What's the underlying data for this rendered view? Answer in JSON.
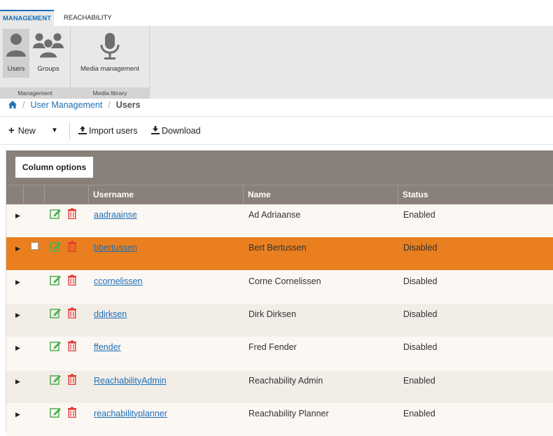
{
  "tabs": {
    "management": "MANAGEMENT",
    "reachability": "REACHABILITY"
  },
  "ribbon": {
    "users_label": "Users",
    "groups_label": "Groups",
    "media_label": "Media management",
    "group1_label": "Management",
    "group2_label": "Media library"
  },
  "breadcrumb": {
    "home_icon": "home-icon",
    "separator": "/",
    "section": "User Management",
    "current": "Users"
  },
  "toolbar": {
    "new_label": "New",
    "import_label": "Import users",
    "download_label": "Download"
  },
  "grid": {
    "column_options_label": "Column options",
    "headers": {
      "username": "Username",
      "name": "Name",
      "status": "Status"
    },
    "rows": [
      {
        "username": "aadraainse",
        "name": "Ad Adriaanse",
        "status": "Enabled"
      },
      {
        "username": "bbertussen",
        "name": "Bert Bertussen",
        "status": "Disabled"
      },
      {
        "username": "ccornelissen",
        "name": "Corne Cornelissen",
        "status": "Disabled"
      },
      {
        "username": "ddirksen",
        "name": "Dirk Dirksen",
        "status": "Disabled"
      },
      {
        "username": "ffender",
        "name": "Fred Fender",
        "status": "Disabled"
      },
      {
        "username": "ReachabilityAdmin",
        "name": "Reachability Admin",
        "status": "Enabled"
      },
      {
        "username": "reachabilityplanner",
        "name": "Reachability Planner",
        "status": "Enabled"
      }
    ],
    "selected_row": "bbertussen"
  },
  "colors": {
    "accent_blue": "#1c6fb7",
    "selected_row": "#e97f1e",
    "header_bg": "#888079",
    "edit_icon": "#4caf50",
    "delete_icon": "#e53935"
  }
}
